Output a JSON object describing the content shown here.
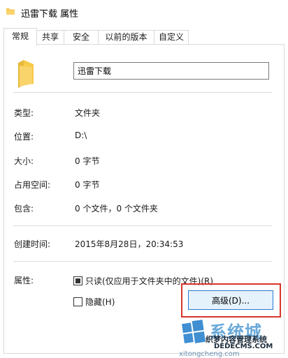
{
  "window": {
    "title": "迅雷下载 属性",
    "icon": "folder-icon"
  },
  "tabs": [
    {
      "label": "常规",
      "active": true
    },
    {
      "label": "共享",
      "active": false
    },
    {
      "label": "安全",
      "active": false
    },
    {
      "label": "以前的版本",
      "active": false
    },
    {
      "label": "自定义",
      "active": false
    }
  ],
  "general": {
    "folder_name": "迅雷下载",
    "type_label": "类型:",
    "type_value": "文件夹",
    "location_label": "位置:",
    "location_value": "D:\\",
    "size_label": "大小:",
    "size_value": "0 字节",
    "size_on_disk_label": "占用空间:",
    "size_on_disk_value": "0 字节",
    "contains_label": "包含:",
    "contains_value": "0 个文件，0 个文件夹",
    "created_label": "创建时间:",
    "created_value": "2015年8月28日，20:34:53",
    "attributes_label": "属性:",
    "readonly_label": "只读(仅应用于文件夹中的文件)(R)",
    "readonly_checked": true,
    "hidden_label": "隐藏(H)",
    "hidden_checked": false,
    "advanced_button": "高级(D)..."
  },
  "watermark": {
    "brand": "系统城",
    "cn": "织梦内容管理系统",
    "dede": "DEDECMS.COM",
    "sub": "xitongcheng.com"
  },
  "colors": {
    "folder": "#f6c344",
    "highlight": "#d9342b",
    "button_border": "#2a7ad4",
    "button_bg": "#e5f1fb"
  }
}
